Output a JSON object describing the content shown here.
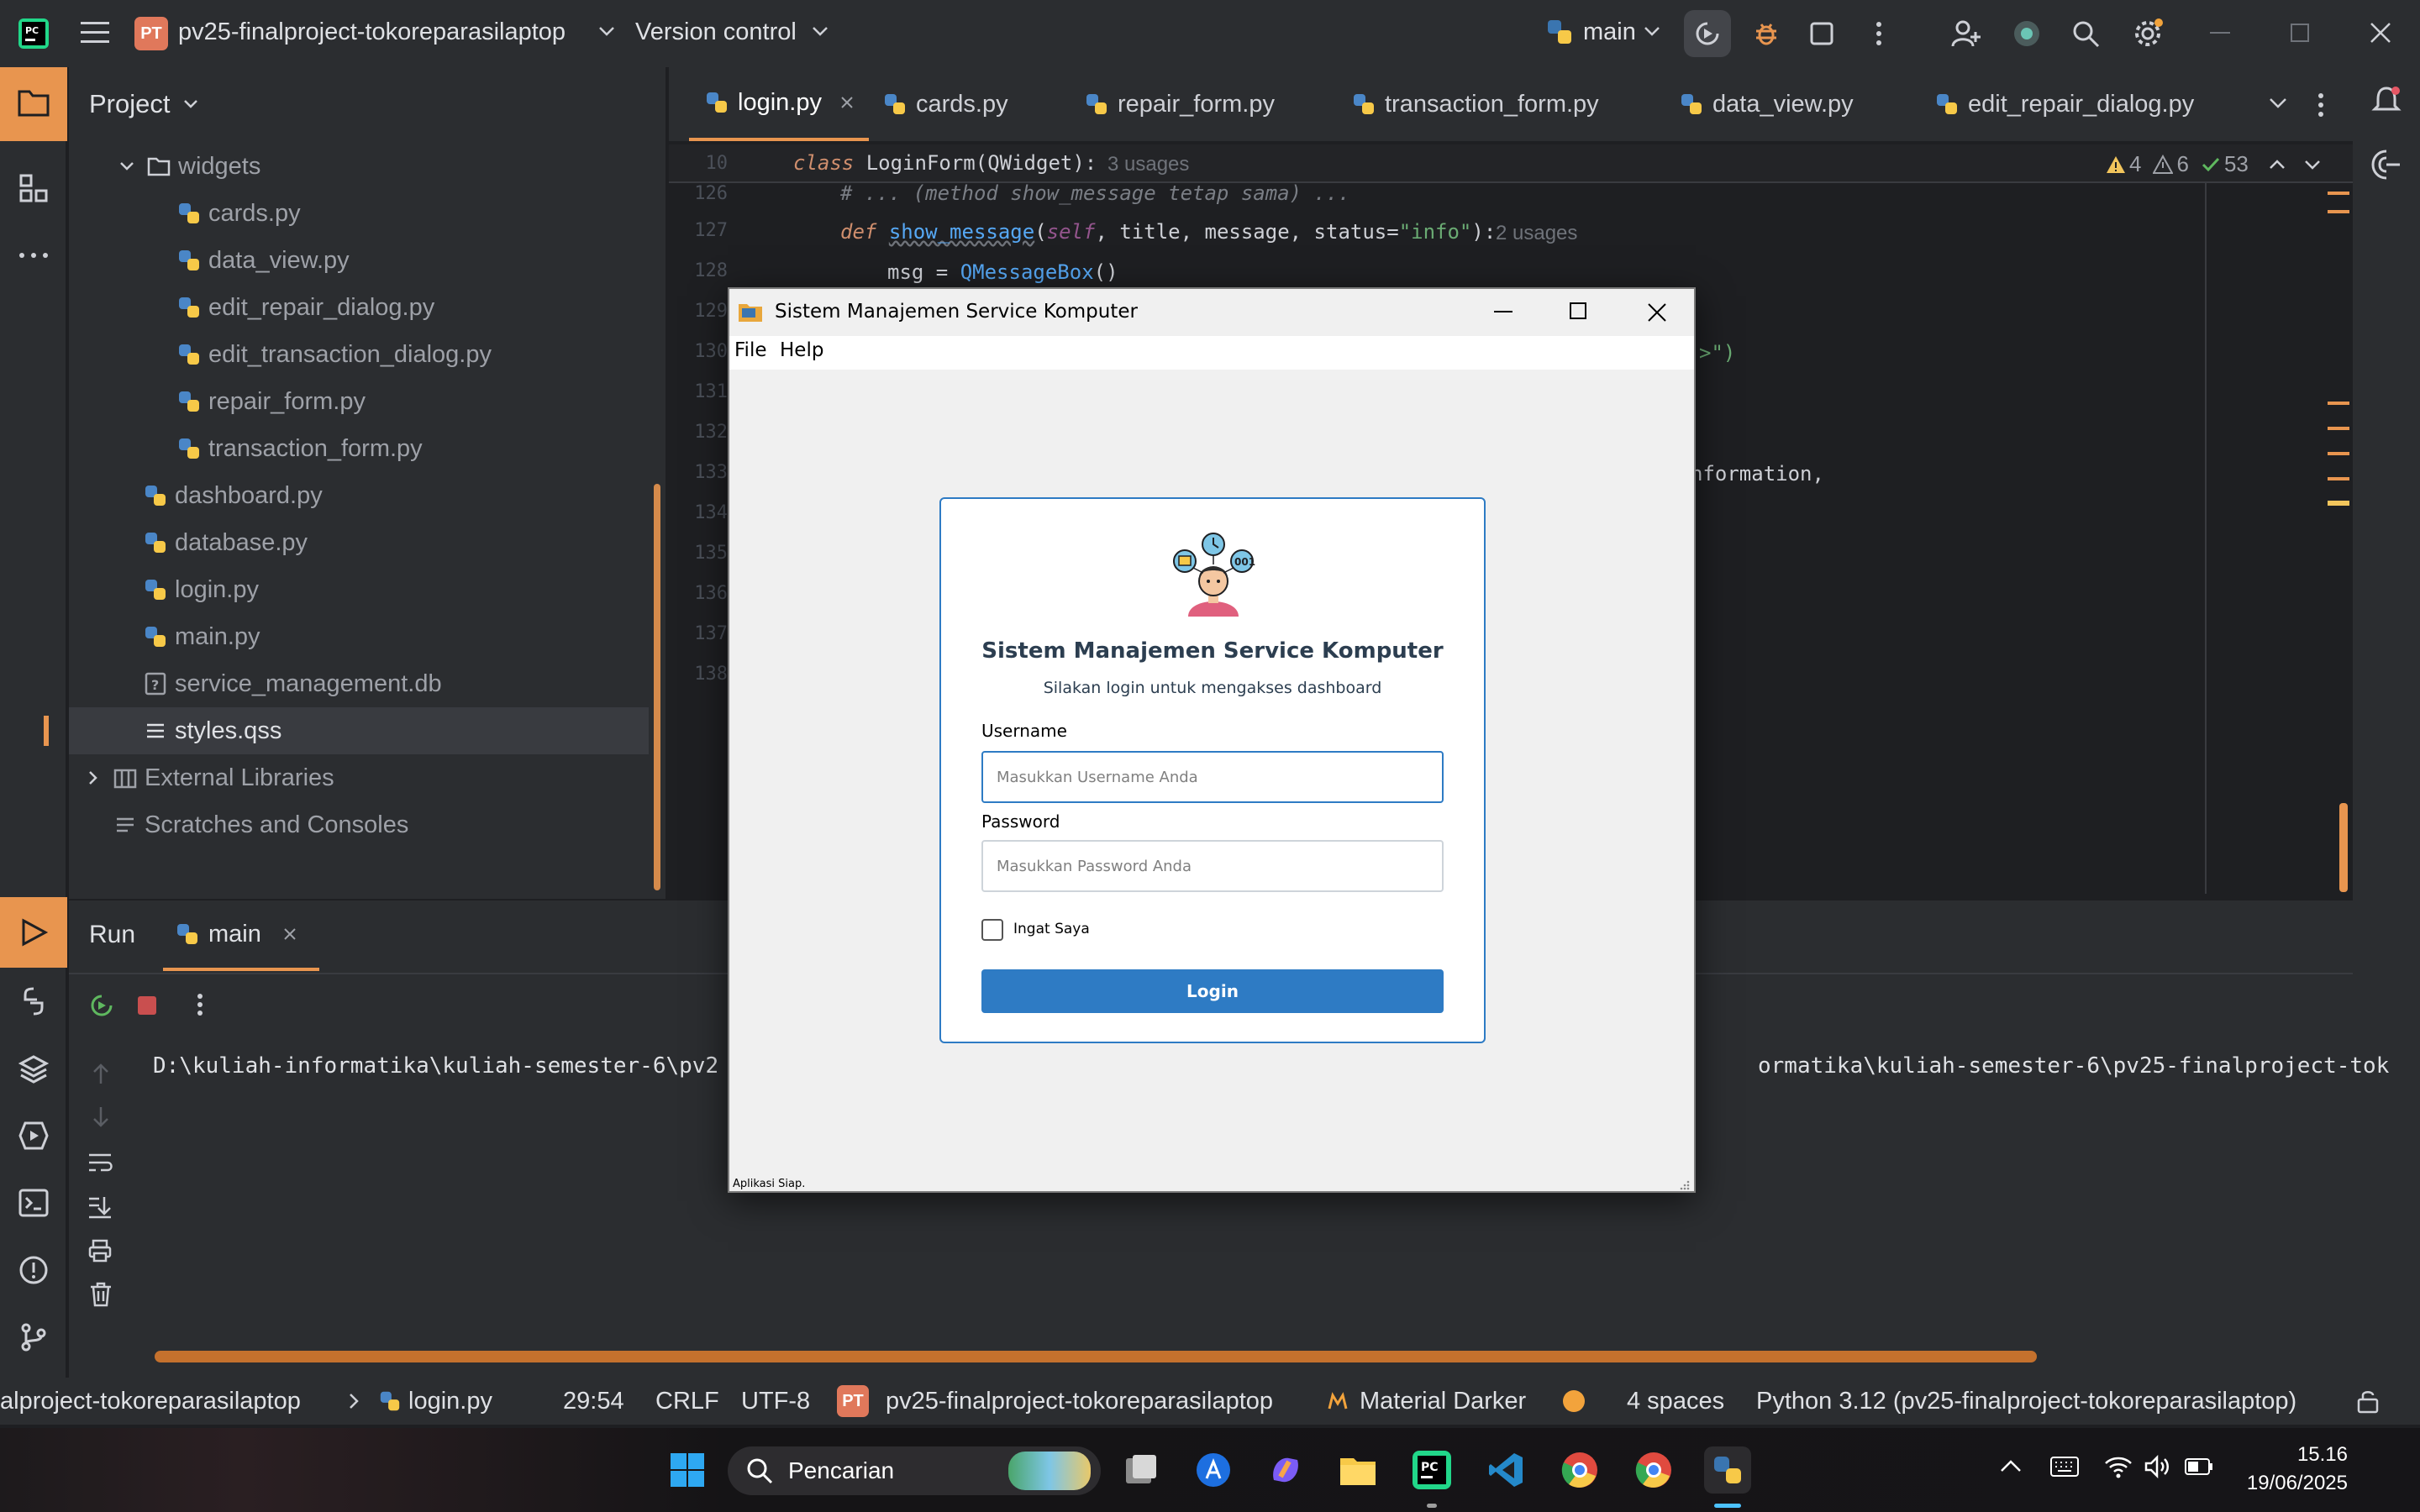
{
  "ide": {
    "project_badge": "PT",
    "project_name": "pv25-finalproject-tokoreparasilaptop",
    "version_control": "Version control",
    "branch": "main"
  },
  "project_panel": {
    "title": "Project",
    "tree": [
      {
        "label": "widgets",
        "type": "folder"
      },
      {
        "label": "cards.py",
        "type": "python"
      },
      {
        "label": "data_view.py",
        "type": "python"
      },
      {
        "label": "edit_repair_dialog.py",
        "type": "python"
      },
      {
        "label": "edit_transaction_dialog.py",
        "type": "python"
      },
      {
        "label": "repair_form.py",
        "type": "python"
      },
      {
        "label": "transaction_form.py",
        "type": "python"
      },
      {
        "label": "dashboard.py",
        "type": "python"
      },
      {
        "label": "database.py",
        "type": "python"
      },
      {
        "label": "login.py",
        "type": "python"
      },
      {
        "label": "main.py",
        "type": "python"
      },
      {
        "label": "service_management.db",
        "type": "unknown"
      },
      {
        "label": "styles.qss",
        "type": "text"
      },
      {
        "label": "External Libraries",
        "type": "library"
      },
      {
        "label": "Scratches and Consoles",
        "type": "scratch"
      }
    ]
  },
  "editor": {
    "tabs": [
      "login.py",
      "cards.py",
      "repair_form.py",
      "transaction_form.py",
      "data_view.py",
      "edit_repair_dialog.py"
    ],
    "active_tab": "login.py",
    "sticky": {
      "line": "10",
      "kw": "class",
      "name": "LoginForm",
      "base": "(QWidget):",
      "usages": "3 usages"
    },
    "inspections": {
      "warnings": "4",
      "weak_warnings": "6",
      "ok": "53"
    },
    "line_numbers": [
      "126",
      "127",
      "128",
      "129",
      "130",
      "131",
      "132",
      "133",
      "134",
      "135",
      "136",
      "137",
      "138"
    ],
    "lines": {
      "l126": "# ... (method show_message tetap sama) ...",
      "l127_def": "def",
      "l127_name": "show_message",
      "l127_self": "self",
      "l127_rest": ", title, message, status=",
      "l127_str": "\"info\"",
      "l127_end": "):",
      "l127_usages": "2 usages",
      "l128_var": "msg = ",
      "l128_fn": "QMessageBox",
      "l128_end": "()",
      "l130_tail": ">\")",
      "l133_tail": "nformation,"
    }
  },
  "run_panel": {
    "title": "Run",
    "tab": "main",
    "output_left": "D:\\kuliah-informatika\\kuliah-semester-6\\pv2",
    "output_right": "ormatika\\kuliah-semester-6\\pv25-finalproject-tok"
  },
  "status_bar": {
    "breadcrumb_project": "alproject-tokoreparasilaptop",
    "breadcrumb_file": "login.py",
    "position": "29:54",
    "line_sep": "CRLF",
    "encoding": "UTF-8",
    "project_badge": "PT",
    "project": "pv25-finalproject-tokoreparasilaptop",
    "theme": "Material Darker",
    "indent": "4 spaces",
    "interpreter": "Python 3.12 (pv25-finalproject-tokoreparasilaptop)"
  },
  "taskbar": {
    "search": "Pencarian",
    "time": "15.16",
    "date": "19/06/2025"
  },
  "dialog": {
    "title": "Sistem Manajemen Service Komputer",
    "menu": [
      "File",
      "Help"
    ],
    "heading": "Sistem Manajemen Service Komputer",
    "subheading": "Silakan login untuk mengakses dashboard",
    "username_label": "Username",
    "username_placeholder": "Masukkan Username Anda",
    "password_label": "Password",
    "password_placeholder": "Masukkan Password Anda",
    "remember_label": "Ingat Saya",
    "login_button": "Login",
    "status": "Aplikasi Siap."
  },
  "colors": {
    "accent": "#2e7bc4",
    "ide_bg": "#1e1f22",
    "ide_panel": "#2b2d30",
    "tab_underline": "#e8954f"
  }
}
